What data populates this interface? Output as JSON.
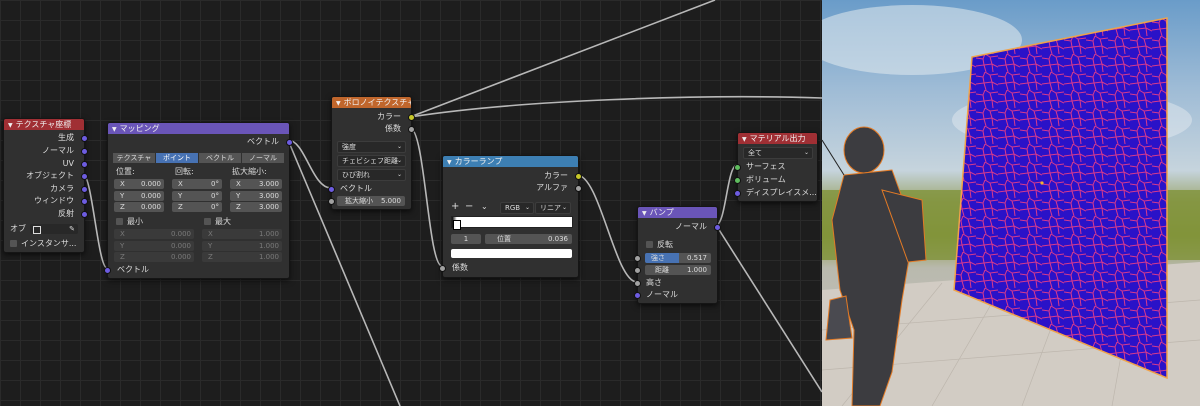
{
  "nodes": {
    "tex_coord": {
      "title": "テクスチャ座標",
      "outputs": [
        "生成",
        "ノーマル",
        "UV",
        "オブジェクト",
        "カメラ",
        "ウィンドウ",
        "反射"
      ],
      "object_label": "オブ",
      "instancer_label": "インスタンサ..."
    },
    "mapping": {
      "title": "マッピング",
      "output": "ベクトル",
      "tabs": [
        "テクスチャ",
        "ポイント",
        "ベクトル",
        "ノーマル"
      ],
      "active_tab": "ポイント",
      "col_headers": [
        "位置:",
        "回転:",
        "拡大縮小:"
      ],
      "location": [
        {
          "axis": "X",
          "value": "0.000"
        },
        {
          "axis": "Y",
          "value": "0.000"
        },
        {
          "axis": "Z",
          "value": "0.000"
        }
      ],
      "rotation": [
        {
          "axis": "X",
          "value": "0°"
        },
        {
          "axis": "Y",
          "value": "0°"
        },
        {
          "axis": "Z",
          "value": "0°"
        }
      ],
      "scale": [
        {
          "axis": "X",
          "value": "3.000"
        },
        {
          "axis": "Y",
          "value": "3.000"
        },
        {
          "axis": "Z",
          "value": "3.000"
        }
      ],
      "min_label": "最小",
      "max_label": "最大",
      "min": [
        {
          "axis": "X",
          "value": "0.000"
        },
        {
          "axis": "Y",
          "value": "0.000"
        },
        {
          "axis": "Z",
          "value": "0.000"
        }
      ],
      "max": [
        {
          "axis": "X",
          "value": "1.000"
        },
        {
          "axis": "Y",
          "value": "1.000"
        },
        {
          "axis": "Z",
          "value": "1.000"
        }
      ],
      "input": "ベクトル"
    },
    "voronoi": {
      "title": "ボロノイテクスチャ",
      "outputs": [
        "カラー",
        "係数"
      ],
      "dropdowns": [
        "強度",
        "チェビシェフ距離",
        "ひび割れ"
      ],
      "vector_label": "ベクトル",
      "scale_label": "拡大縮小",
      "scale_value": "5.000"
    },
    "color_ramp": {
      "title": "カラーランプ",
      "outputs": [
        "カラー",
        "アルファ"
      ],
      "mode": "RGB",
      "interp": "リニア",
      "index": "1",
      "pos_label": "位置",
      "pos_value": "0.036",
      "input": "係数"
    },
    "bump": {
      "title": "バンプ",
      "output": "ノーマル",
      "invert_label": "反転",
      "strength_label": "強さ",
      "strength_value": "0.517",
      "strength_fraction": 0.517,
      "distance_label": "距離",
      "distance_value": "1.000",
      "inputs": [
        "高さ",
        "ノーマル"
      ]
    },
    "material_output": {
      "title": "マテリアル出力",
      "target": "全て",
      "inputs": [
        "サーフェス",
        "ボリューム",
        "ディスプレイスメ..."
      ]
    }
  }
}
